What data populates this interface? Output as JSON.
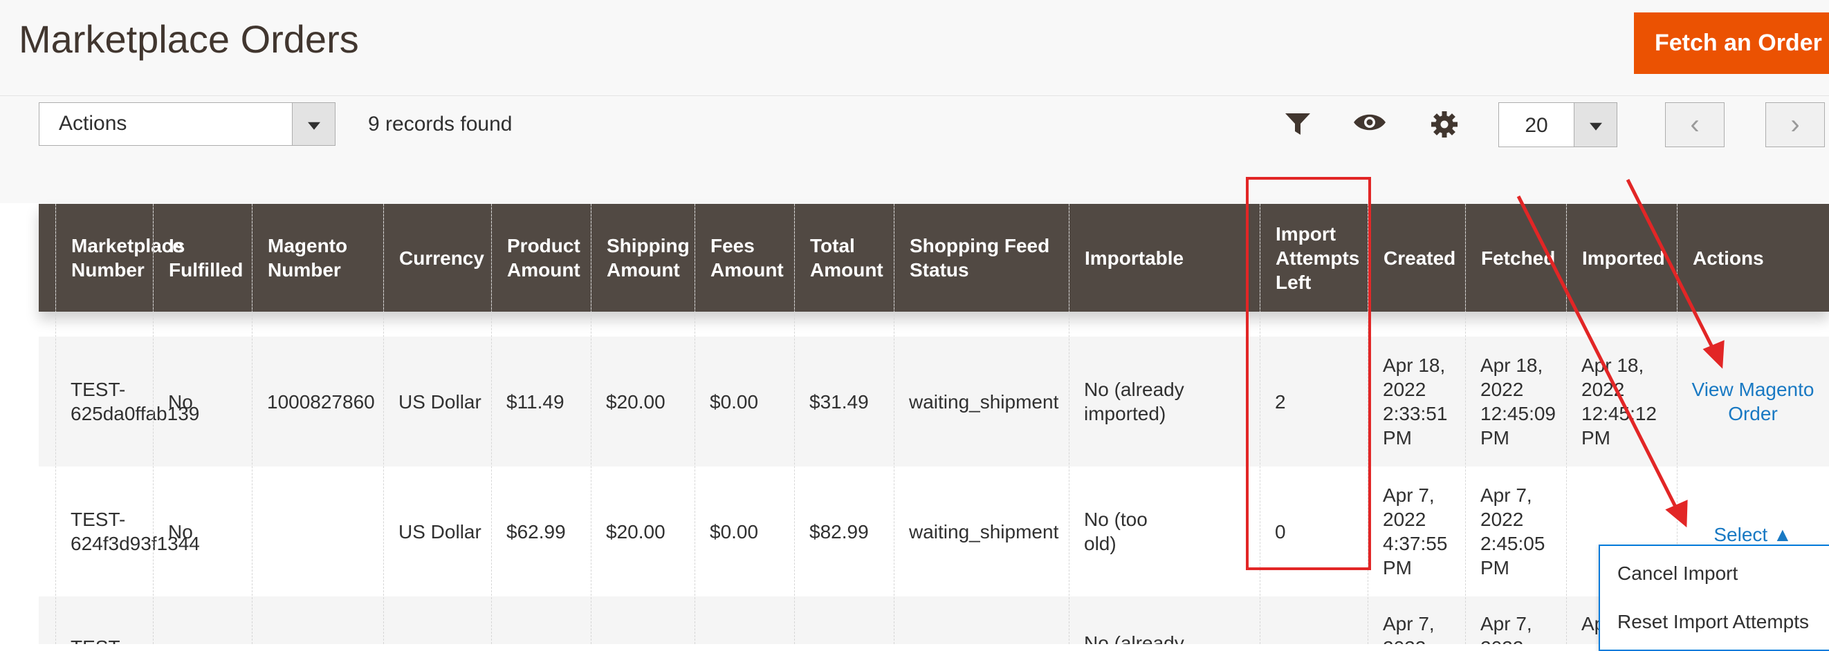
{
  "header": {
    "title": "Marketplace Orders",
    "fetch_label": "Fetch an Order"
  },
  "toolbar": {
    "actions_label": "Actions",
    "records": "9 records found",
    "per_page": "20",
    "prev": "‹",
    "next": "›"
  },
  "icons": {
    "filter": "filter-icon",
    "columns": "eye-icon",
    "settings": "gear-icon"
  },
  "table": {
    "headers": [
      "Marketplace Number",
      "Is Fulfilled",
      "Magento Number",
      "Currency",
      "Product Amount",
      "Shipping Amount",
      "Fees Amount",
      "Total Amount",
      "Shopping Feed Status",
      "Importable",
      "Import Attempts Left",
      "Created",
      "Fetched",
      "Imported",
      "Actions"
    ],
    "rows": [
      {
        "marketplace_number": "TEST-625da0ffab139",
        "is_fulfilled": "No",
        "magento_number": "1000827860",
        "currency": "US Dollar",
        "product_amount": "$11.49",
        "shipping_amount": "$20.00",
        "fees_amount": "$0.00",
        "total_amount": "$31.49",
        "feed_status": "waiting_shipment",
        "importable": "No (already imported)",
        "attempts_left": "2",
        "created": "Apr 18, 2022 2:33:51 PM",
        "fetched": "Apr 18, 2022 12:45:09 PM",
        "imported": "Apr 18, 2022 12:45:12 PM",
        "action": "View Magento Order"
      },
      {
        "marketplace_number": "TEST-624f3d93f1344",
        "is_fulfilled": "No",
        "magento_number": "",
        "currency": "US Dollar",
        "product_amount": "$62.99",
        "shipping_amount": "$20.00",
        "fees_amount": "$0.00",
        "total_amount": "$82.99",
        "feed_status": "waiting_shipment",
        "importable": "No (too old)",
        "attempts_left": "0",
        "created": "Apr 7, 2022 4:37:55 PM",
        "fetched": "Apr 7, 2022 2:45:05 PM",
        "imported": "",
        "action": "Select ▲"
      },
      {
        "marketplace_number": "TEST-",
        "is_fulfilled": "",
        "magento_number": "",
        "currency": "",
        "product_amount": "",
        "shipping_amount": "",
        "fees_amount": "",
        "total_amount": "",
        "feed_status": "",
        "importable": "No (already",
        "attempts_left": "",
        "created": "Apr 7, 2022",
        "fetched": "Apr 7, 2022",
        "imported": "Ap",
        "action": ""
      }
    ]
  },
  "dropdown": {
    "items": [
      "Cancel Import",
      "Reset Import Attempts"
    ]
  },
  "colors": {
    "accent": "#eb5202",
    "header_bg": "#514943",
    "link": "#1979c3",
    "highlight": "#e22626"
  }
}
